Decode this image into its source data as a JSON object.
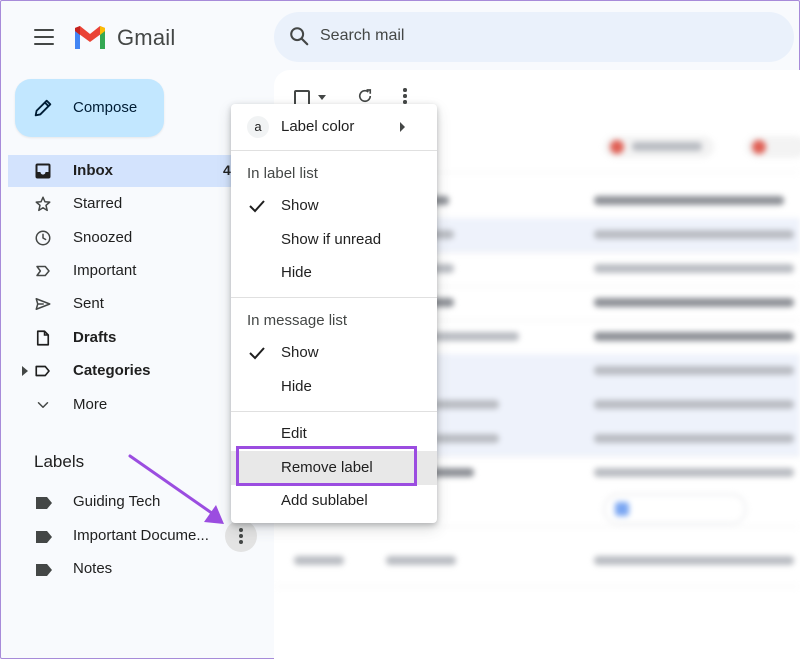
{
  "app": {
    "name": "Gmail"
  },
  "search": {
    "placeholder": "Search mail"
  },
  "compose": {
    "label": "Compose"
  },
  "nav": {
    "inbox": {
      "label": "Inbox",
      "count": "4"
    },
    "starred": {
      "label": "Starred"
    },
    "snoozed": {
      "label": "Snoozed"
    },
    "important": {
      "label": "Important"
    },
    "sent": {
      "label": "Sent"
    },
    "drafts": {
      "label": "Drafts"
    },
    "categories": {
      "label": "Categories"
    },
    "more": {
      "label": "More"
    }
  },
  "labels": {
    "heading": "Labels",
    "items": [
      {
        "name": "Guiding Tech"
      },
      {
        "name": "Important Docume..."
      },
      {
        "name": "Notes"
      }
    ]
  },
  "menu": {
    "label_color": {
      "icon_letter": "a",
      "label": "Label color"
    },
    "in_label_list": {
      "heading": "In label list",
      "options": [
        "Show",
        "Show if unread",
        "Hide"
      ],
      "selected": "Show"
    },
    "in_message_list": {
      "heading": "In message list",
      "options": [
        "Show",
        "Hide"
      ],
      "selected": "Show"
    },
    "actions": [
      "Edit",
      "Remove label",
      "Add sublabel"
    ],
    "highlighted": "Remove label"
  },
  "colors": {
    "accent_highlight": "#9b4de0",
    "compose_bg": "#c2e7ff",
    "active_nav_bg": "#d3e3fd",
    "search_bg": "#eaf1fb"
  }
}
